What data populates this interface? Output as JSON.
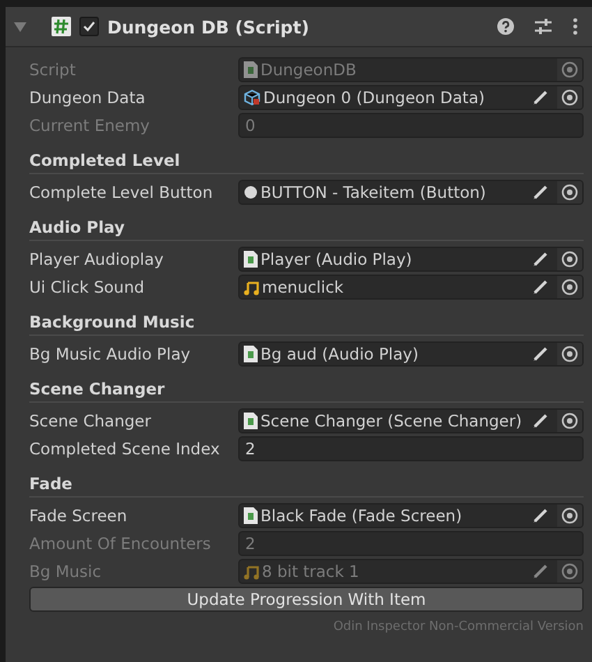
{
  "component": {
    "title": "Dungeon DB (Script)",
    "expanded": true,
    "enabled": true
  },
  "sections": [
    {
      "rows": [
        {
          "label": "Script",
          "kind": "script",
          "value": "DungeonDB",
          "disabled": true,
          "editable": false
        },
        {
          "label": "Dungeon Data",
          "kind": "data",
          "value": "Dungeon 0 (Dungeon Data)",
          "disabled": false,
          "editable": true
        },
        {
          "label": "Current Enemy",
          "kind": "number",
          "value": "0",
          "disabled": true
        }
      ]
    },
    {
      "title": "Completed Level",
      "rows": [
        {
          "label": "Complete Level Button",
          "kind": "button",
          "value": "BUTTON - Takeitem (Button)",
          "disabled": false,
          "editable": true
        }
      ]
    },
    {
      "title": "Audio Play",
      "rows": [
        {
          "label": "Player Audioplay",
          "kind": "script",
          "value": "Player (Audio Play)",
          "disabled": false,
          "editable": true
        },
        {
          "label": "Ui Click Sound",
          "kind": "audio",
          "value": "menuclick",
          "disabled": false,
          "editable": true
        }
      ]
    },
    {
      "title": "Background Music",
      "rows": [
        {
          "label": "Bg Music Audio Play",
          "kind": "script",
          "value": "Bg aud (Audio Play)",
          "disabled": false,
          "editable": true
        }
      ]
    },
    {
      "title": "Scene Changer",
      "rows": [
        {
          "label": "Scene Changer",
          "kind": "script",
          "value": "Scene Changer (Scene Changer)",
          "disabled": false,
          "editable": true
        },
        {
          "label": "Completed Scene Index",
          "kind": "number",
          "value": "2",
          "disabled": false
        }
      ]
    },
    {
      "title": "Fade",
      "rows": [
        {
          "label": "Fade Screen",
          "kind": "script",
          "value": "Black Fade (Fade Screen)",
          "disabled": false,
          "editable": true
        },
        {
          "label": "Amount Of Encounters",
          "kind": "number",
          "value": "2",
          "disabled": true
        },
        {
          "label": "Bg Music",
          "kind": "audio",
          "value": "8 bit track 1",
          "disabled": true,
          "editable": true
        }
      ]
    }
  ],
  "action_button": "Update Progression With Item",
  "footer": "Odin Inspector Non-Commercial Version"
}
